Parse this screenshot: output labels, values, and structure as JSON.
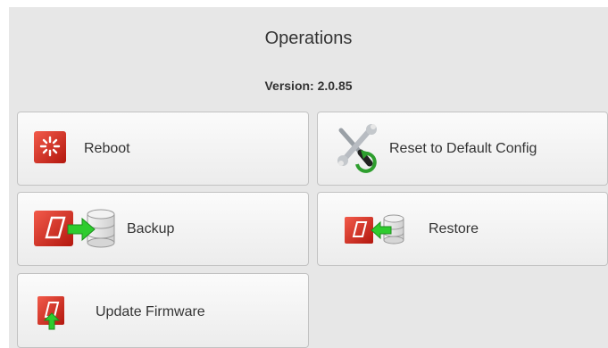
{
  "header": {
    "title": "Operations",
    "version": "Version: 2.0.85"
  },
  "buttons": {
    "reboot": {
      "label": "Reboot",
      "icon": "reboot-icon"
    },
    "reset": {
      "label": "Reset to Default Config",
      "icon": "tools-reset-icon"
    },
    "backup": {
      "label": "Backup",
      "icon": "backup-icon"
    },
    "restore": {
      "label": "Restore",
      "icon": "restore-icon"
    },
    "update": {
      "label": "Update Firmware",
      "icon": "firmware-upload-icon"
    }
  },
  "colors": {
    "panel": "#e7e7e7",
    "accent_red": "#d42a1f",
    "accent_green": "#2ecc2e"
  }
}
